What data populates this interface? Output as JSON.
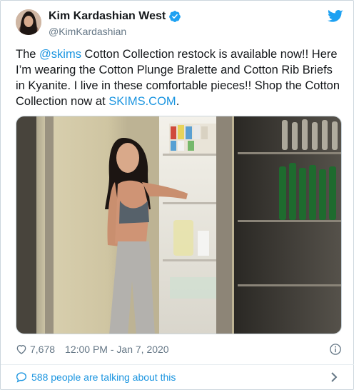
{
  "tweet": {
    "display_name": "Kim Kardashian West",
    "handle": "@KimKardashian",
    "text_parts": [
      {
        "t": "The ",
        "link": false
      },
      {
        "t": "@skims",
        "link": true
      },
      {
        "t": " Cotton Collection restock is available now!! Here I’m wearing the Cotton Plunge Bralette and Cotton Rib Briefs in Kyanite. I live in these comfortable pieces!! Shop the Cotton Collection now at ",
        "link": false
      },
      {
        "t": "SKIMS.COM",
        "link": true
      },
      {
        "t": ".",
        "link": false
      }
    ],
    "likes": "7,678",
    "timestamp": "12:00 PM - Jan 7, 2020",
    "conversation": "588 people are talking about this"
  },
  "icons": {
    "verified": "verified-badge-icon",
    "bird": "twitter-bird-icon",
    "heart": "heart-icon",
    "info": "info-icon",
    "bubble": "speech-bubble-icon",
    "chevron": "chevron-right-icon"
  },
  "colors": {
    "link": "#1b95e0",
    "secondary_text": "#657786",
    "primary_text": "#14171a",
    "border": "#ccd6dd"
  }
}
